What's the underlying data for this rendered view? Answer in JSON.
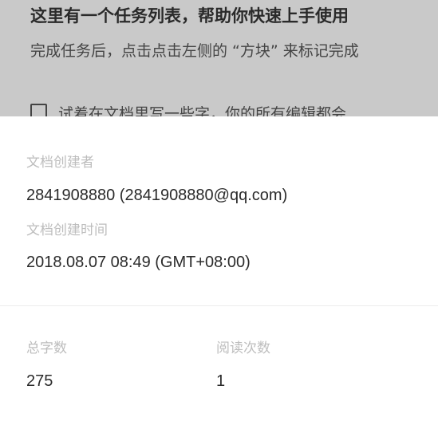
{
  "background_doc": {
    "title": "这里有一个任务列表，帮助你快速上手使用",
    "description": "完成任务后，点击点击左侧的 “方块” 来标记完成",
    "task_text": "试着在文档里写一些字，你的所有编辑都会"
  },
  "doc_info": {
    "creator_label": "文档创建者",
    "creator_value": "2841908880  (2841908880@qq.com)",
    "created_time_label": "文档创建时间",
    "created_time_value": "2018.08.07 08:49 (GMT+08:00)",
    "word_count_label": "总字数",
    "word_count_value": "275",
    "read_count_label": "阅读次数",
    "read_count_value": "1"
  },
  "colors": {
    "overlay": "#c9c9c9",
    "sheet": "#ffffff",
    "label": "#bdbdbd",
    "value": "#2b2b2b"
  }
}
